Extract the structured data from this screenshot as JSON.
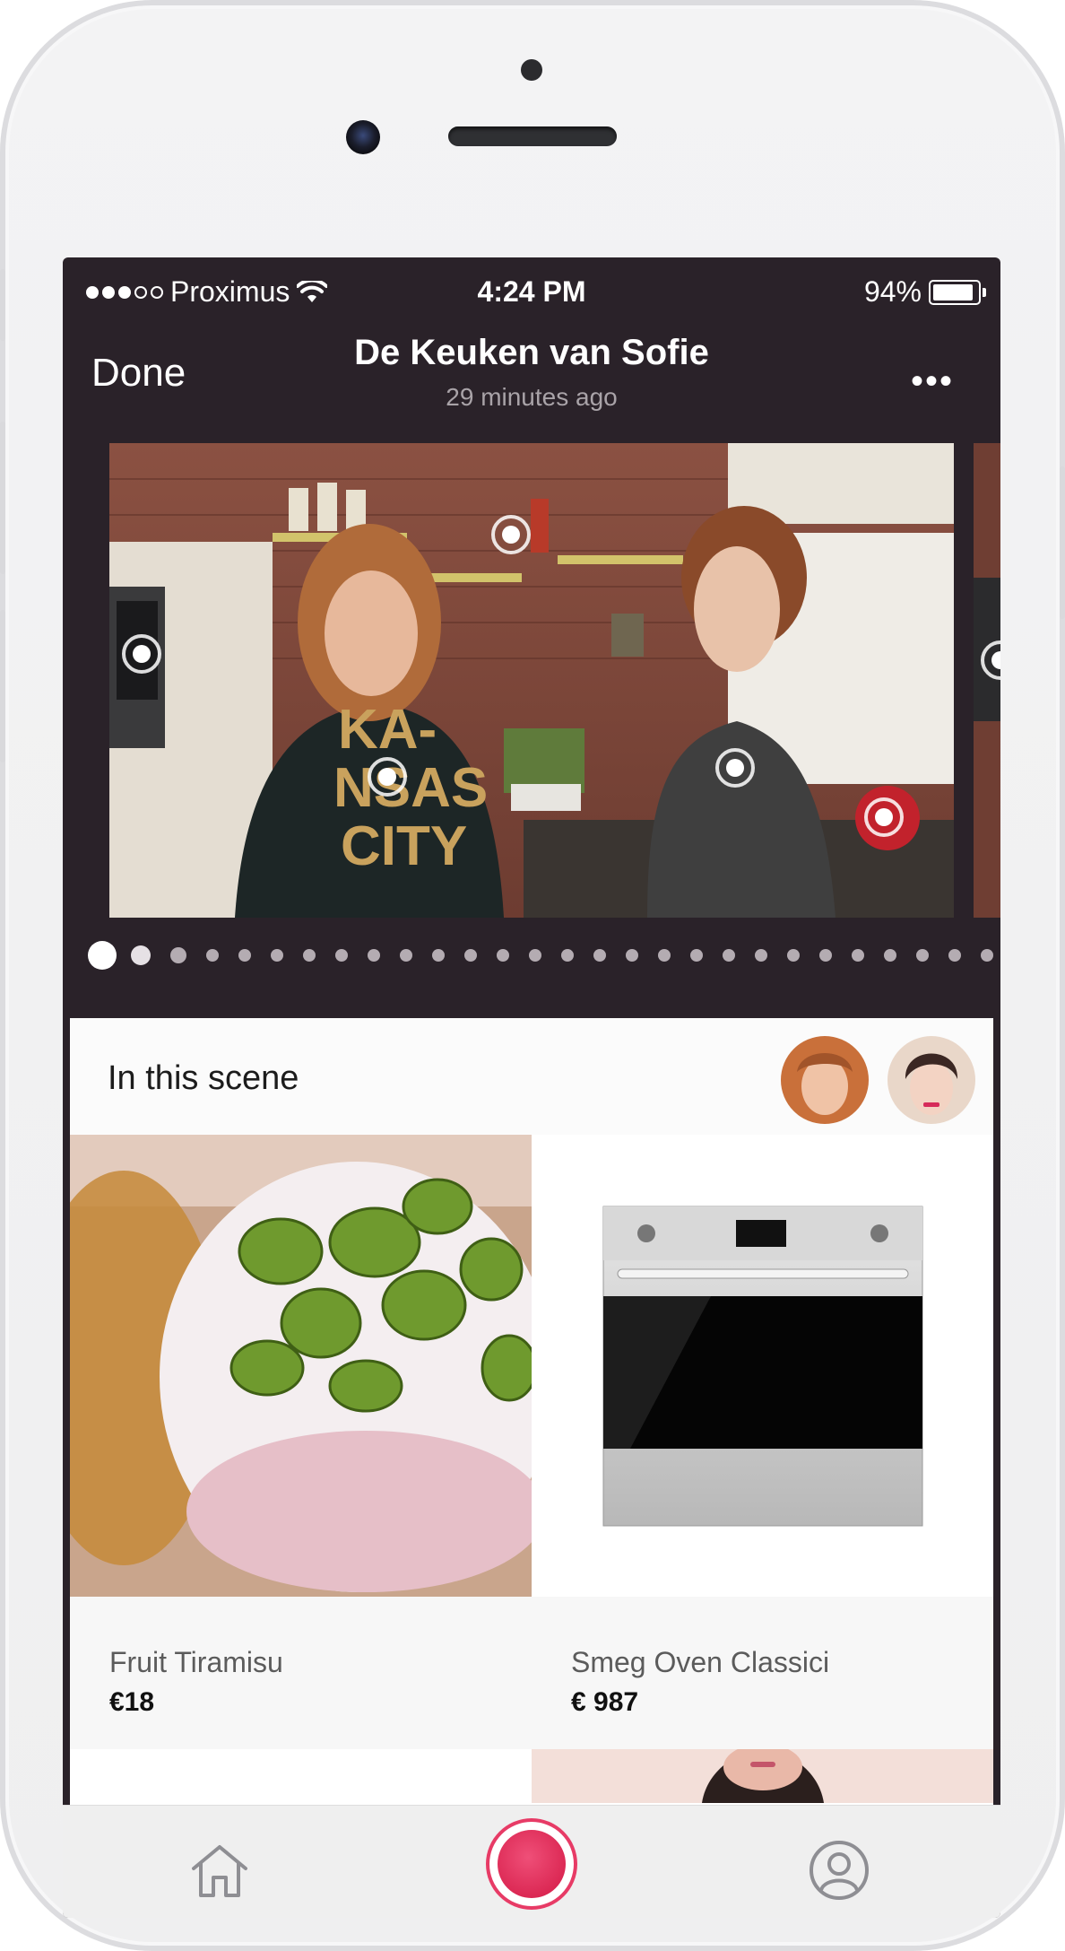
{
  "status_bar": {
    "carrier": "Proximus",
    "time": "4:24 PM",
    "battery": "94%",
    "battery_level": 0.94,
    "signal_bars_filled": 3,
    "signal_bars_total": 5
  },
  "nav": {
    "done_label": "Done",
    "title": "De Keuken van Sofie",
    "subtitle": "29 minutes ago",
    "more_label": "•••"
  },
  "carousel": {
    "page_count": 28,
    "current_page": 1,
    "hotspot_count": 5
  },
  "scene": {
    "heading": "In this scene",
    "people": [
      {
        "icon": "presenter-avatar"
      },
      {
        "icon": "guest-avatar"
      }
    ],
    "products": [
      {
        "name": "Fruit Tiramisu",
        "price": "€18"
      },
      {
        "name": "Smeg Oven Classici",
        "price": "€ 987"
      }
    ]
  },
  "tab_bar": {
    "items": [
      {
        "icon": "home-icon"
      },
      {
        "icon": "record-icon"
      },
      {
        "icon": "profile-icon"
      }
    ],
    "accent": "#e0295a"
  }
}
